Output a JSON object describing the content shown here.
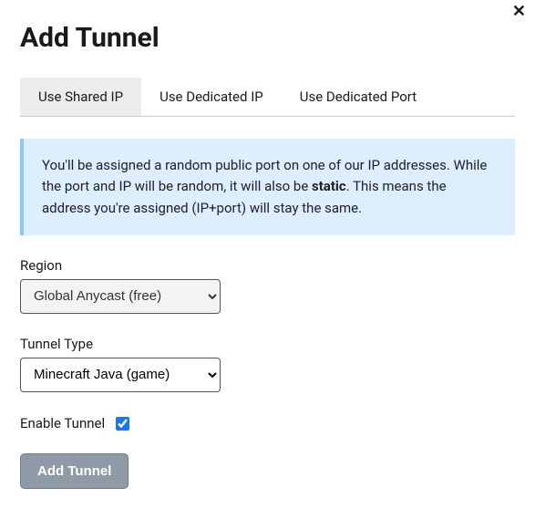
{
  "close_label": "✕",
  "title": "Add Tunnel",
  "tabs": [
    {
      "label": "Use Shared IP",
      "active": true
    },
    {
      "label": "Use Dedicated IP",
      "active": false
    },
    {
      "label": "Use Dedicated Port",
      "active": false
    }
  ],
  "info": {
    "pre": "You'll be assigned a random public port on one of our IP addresses. While the port and IP will be random, it will also be ",
    "bold": "static",
    "post": ". This means the address you're assigned (IP+port) will stay the same."
  },
  "region": {
    "label": "Region",
    "value": "Global Anycast (free)"
  },
  "tunnel_type": {
    "label": "Tunnel Type",
    "value": "Minecraft Java (game)"
  },
  "enable": {
    "label": "Enable Tunnel",
    "checked": true
  },
  "submit_label": "Add Tunnel"
}
